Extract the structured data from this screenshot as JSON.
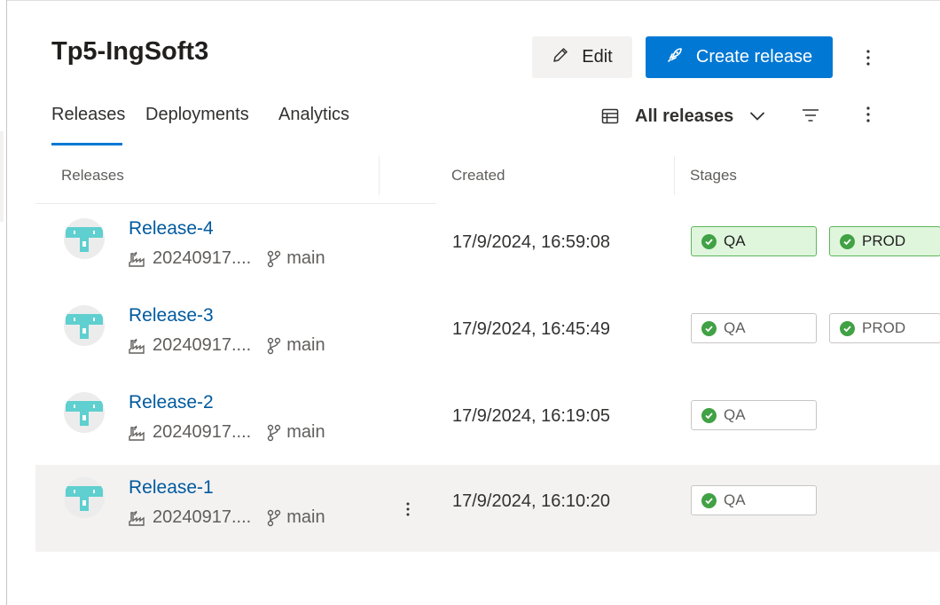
{
  "header": {
    "title": "Tp5-IngSoft3",
    "edit_label": "Edit",
    "create_label": "Create release"
  },
  "tabs": [
    {
      "label": "Releases",
      "selected": true
    },
    {
      "label": "Deployments",
      "selected": false
    },
    {
      "label": "Analytics",
      "selected": false
    }
  ],
  "view": {
    "selected": "All releases"
  },
  "columns": {
    "releases": "Releases",
    "created": "Created",
    "stages": "Stages"
  },
  "rows": [
    {
      "name": "Release-4",
      "build": "20240917....",
      "branch": "main",
      "created": "17/9/2024, 16:59:08",
      "stages": [
        {
          "label": "QA",
          "status": "succeeded",
          "highlighted": true
        },
        {
          "label": "PROD",
          "status": "succeeded",
          "highlighted": true
        }
      ]
    },
    {
      "name": "Release-3",
      "build": "20240917....",
      "branch": "main",
      "created": "17/9/2024, 16:45:49",
      "stages": [
        {
          "label": "QA",
          "status": "succeeded",
          "highlighted": false
        },
        {
          "label": "PROD",
          "status": "succeeded",
          "highlighted": false
        }
      ]
    },
    {
      "name": "Release-2",
      "build": "20240917....",
      "branch": "main",
      "created": "17/9/2024, 16:19:05",
      "stages": [
        {
          "label": "QA",
          "status": "succeeded",
          "highlighted": false
        }
      ]
    },
    {
      "name": "Release-1",
      "build": "20240917....",
      "branch": "main",
      "created": "17/9/2024, 16:10:20",
      "stages": [
        {
          "label": "QA",
          "status": "succeeded",
          "highlighted": false
        }
      ],
      "hovered": true
    }
  ],
  "colors": {
    "accent": "#0078d4",
    "link": "#005a9e",
    "success": "#41a145",
    "success_bg": "#dff6dd",
    "avatar": "#5fcfcf"
  },
  "icons": {
    "edit": "pencil-icon",
    "create": "rocket-icon",
    "more": "more-vertical-icon",
    "view": "table-icon",
    "chevron": "chevron-down-icon",
    "filter": "filter-icon",
    "build": "build-icon",
    "branch": "branch-icon",
    "stage": "check-circle-icon",
    "avatar": "release-pipeline-icon"
  }
}
